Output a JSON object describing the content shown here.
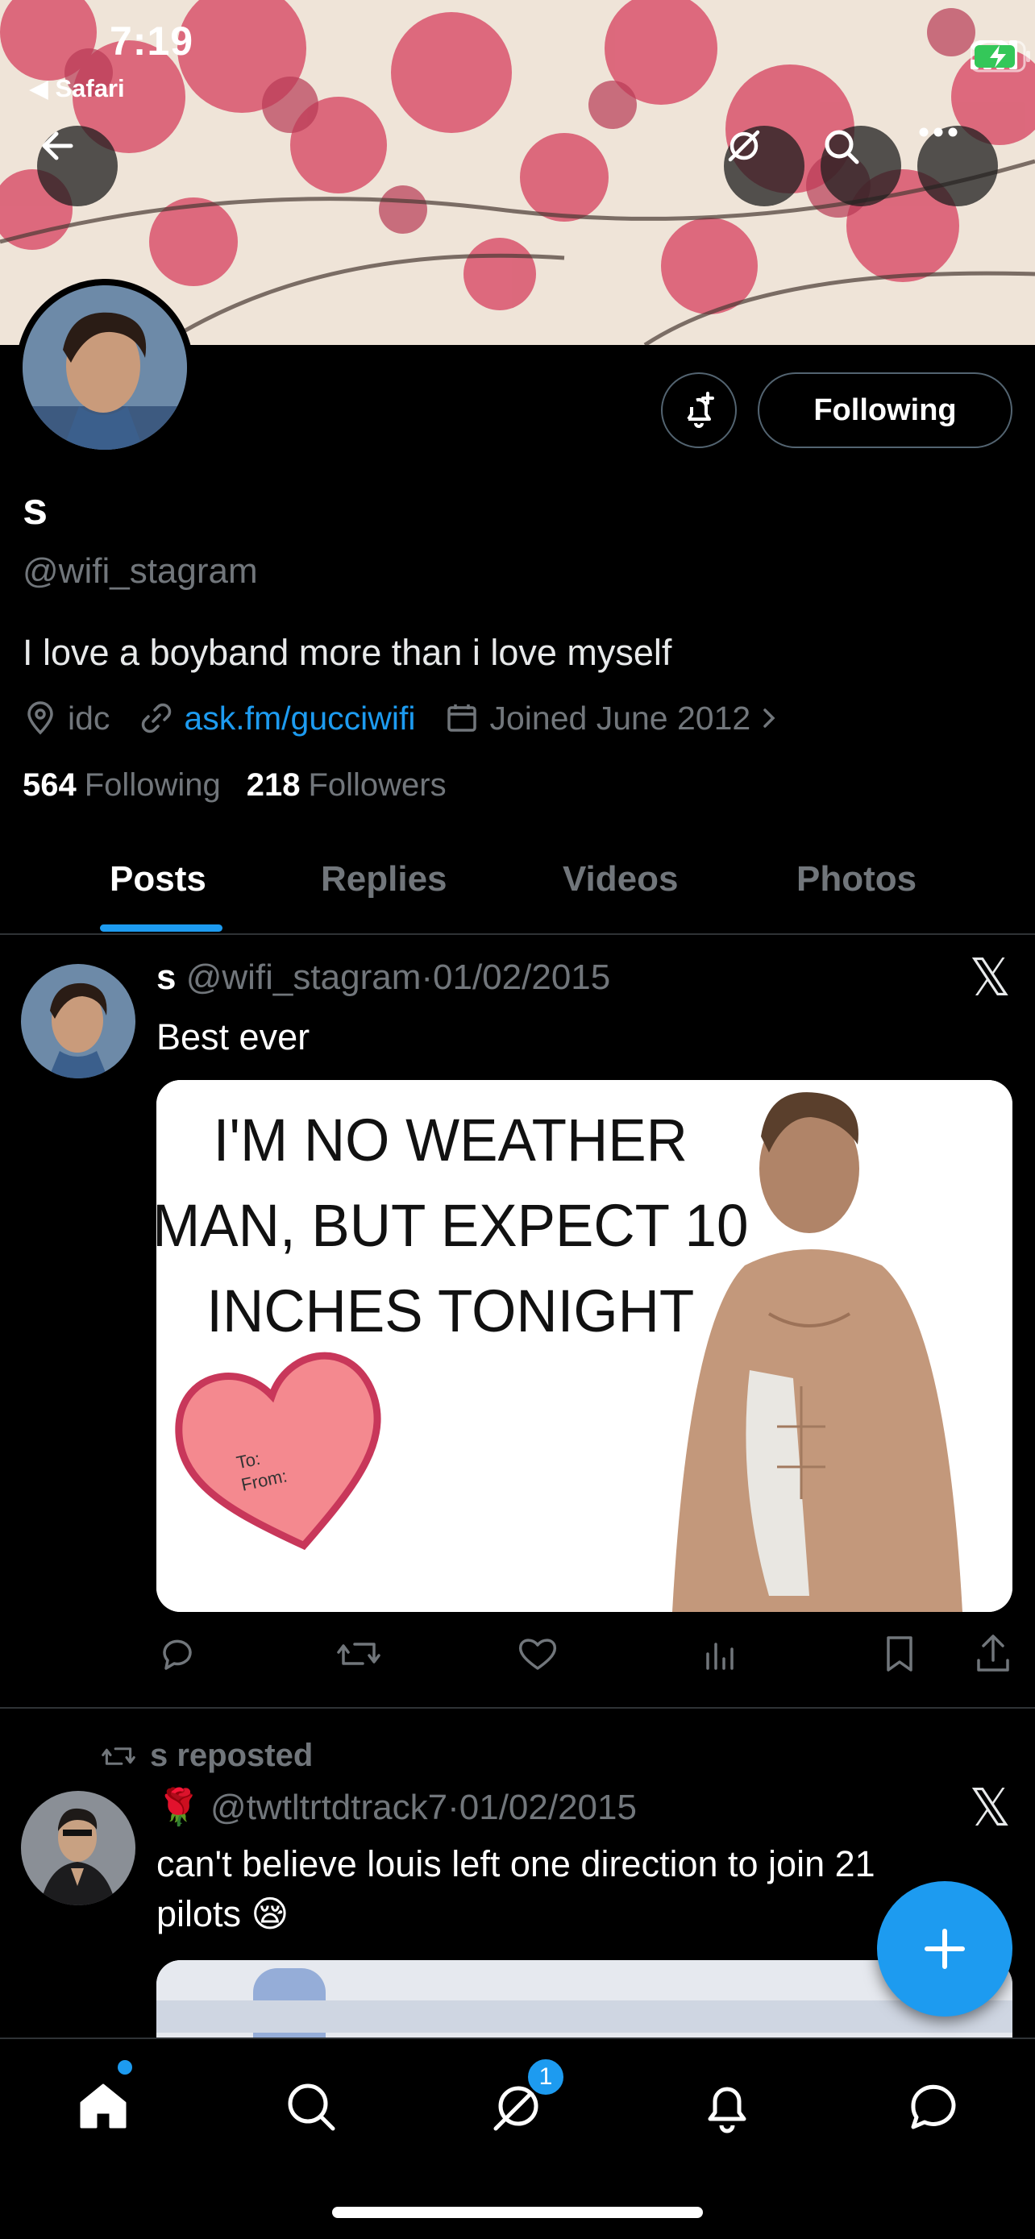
{
  "status_bar": {
    "time": "7:19",
    "back_app": "◀ Safari"
  },
  "profile": {
    "name": "s",
    "handle": "@wifi_stagram",
    "bio": "I love a boyband more than i love myself",
    "location": "idc",
    "link": "ask.fm/gucciwifi",
    "joined": "Joined June 2012",
    "following_count": "564",
    "following_label": "Following",
    "followers_count": "218",
    "followers_label": "Followers",
    "follow_button": "Following"
  },
  "tabs": [
    {
      "label": "Posts",
      "active": true
    },
    {
      "label": "Replies",
      "active": false
    },
    {
      "label": "Videos",
      "active": false
    },
    {
      "label": "Photos",
      "active": false
    }
  ],
  "posts": [
    {
      "name": "s",
      "handle": "@wifi_stagram",
      "sep": "·",
      "date": "01/02/2015",
      "text": "Best ever",
      "image": {
        "caption": "I'M NO WEATHER MAN, BUT EXPECT 10 INCHES TONIGHT",
        "line1": "I'M NO WEATHER",
        "line2": "MAN, BUT EXPECT 10",
        "line3": "INCHES TONIGHT",
        "heart_to": "To:",
        "heart_from": "From:"
      }
    },
    {
      "repost_label": "s reposted",
      "name_emoji": "🌹",
      "handle": "@twtltrtdtrack7",
      "sep": "·",
      "date": "01/02/2015",
      "text_line1": "can't believe louis left one direction to join 21",
      "text_line2": "pilots 😪"
    }
  ],
  "nav": {
    "messages_badge": "1"
  },
  "icons": [
    "back-arrow-icon",
    "grok-icon",
    "search-icon",
    "more-icon",
    "bell-plus-icon",
    "location-icon",
    "link-icon",
    "calendar-icon",
    "chevron-right-icon",
    "x-logo-icon",
    "reply-icon",
    "repost-icon",
    "like-icon",
    "views-icon",
    "bookmark-icon",
    "share-icon",
    "plus-icon",
    "home-icon",
    "explore-icon",
    "grok-nav-icon",
    "notifications-icon",
    "messages-icon"
  ],
  "colors": {
    "accent": "#1d9bf0",
    "background": "#000000",
    "muted": "#71767b",
    "border": "#2f3336"
  }
}
